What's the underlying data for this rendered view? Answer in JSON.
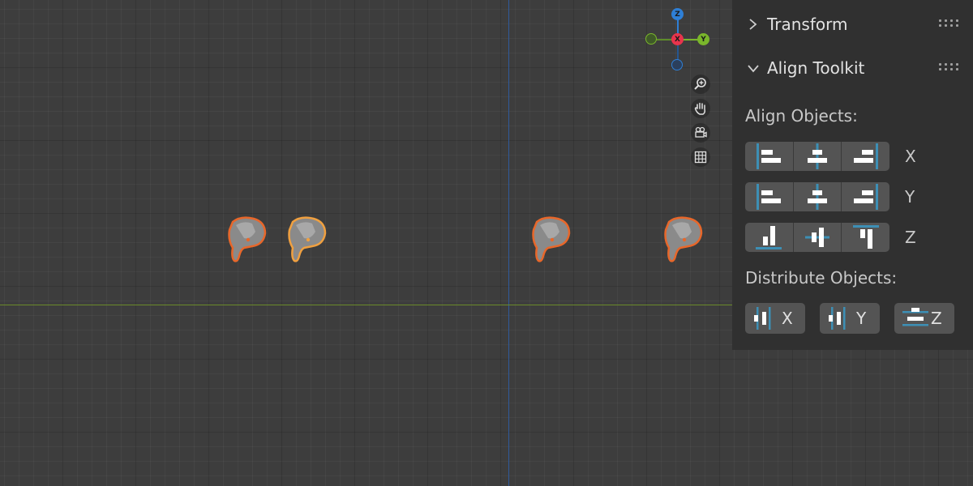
{
  "viewport": {
    "gizmo": {
      "z_label": "Z",
      "x_label": "X",
      "y_label": "Y"
    },
    "nav_tools": [
      "zoom-icon",
      "pan-hand-icon",
      "camera-view-icon",
      "grid-view-icon"
    ],
    "objects_count": 4
  },
  "panel": {
    "transform": {
      "title": "Transform",
      "expanded": false
    },
    "align_toolkit": {
      "title": "Align Toolkit",
      "expanded": true,
      "align_label": "Align Objects:",
      "rows": [
        {
          "axis": "X",
          "buttons": [
            "align-min-icon",
            "align-center-icon",
            "align-max-icon"
          ]
        },
        {
          "axis": "Y",
          "buttons": [
            "align-min-icon",
            "align-center-icon",
            "align-max-icon"
          ]
        },
        {
          "axis": "Z",
          "buttons": [
            "align-bottom-icon",
            "align-middle-icon",
            "align-top-icon"
          ]
        }
      ],
      "distribute_label": "Distribute Objects:",
      "distribute": [
        {
          "label": "X",
          "icon": "distribute-x-icon"
        },
        {
          "label": "Y",
          "icon": "distribute-y-icon"
        },
        {
          "label": "Z",
          "icon": "distribute-z-icon"
        }
      ]
    }
  },
  "colors": {
    "accent_blue": "#3d8fb5",
    "selection_orange": "#e8672a",
    "active_orange": "#f0a040",
    "axis_x_red": "#e8344c",
    "axis_y_green": "#7ab62b",
    "axis_z_blue": "#2e7fd6"
  }
}
